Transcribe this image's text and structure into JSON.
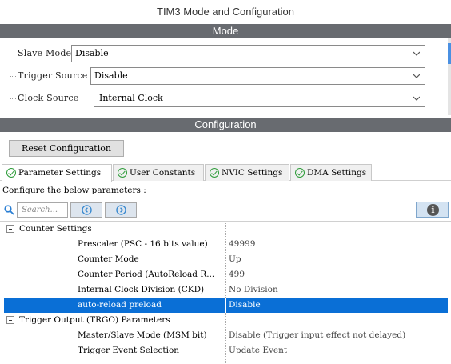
{
  "window": {
    "title": "TIM3 Mode and Configuration"
  },
  "mode": {
    "header": "Mode",
    "fields": [
      {
        "label": "Slave Mode",
        "value": "Disable"
      },
      {
        "label": "Trigger Source",
        "value": "Disable"
      },
      {
        "label": "Clock Source",
        "value": "Internal Clock"
      }
    ]
  },
  "configuration": {
    "header": "Configuration",
    "reset_label": "Reset Configuration",
    "tabs": [
      {
        "label": "Parameter Settings",
        "active": true
      },
      {
        "label": "User Constants",
        "active": false
      },
      {
        "label": "NVIC Settings",
        "active": false
      },
      {
        "label": "DMA Settings",
        "active": false
      }
    ],
    "instruction": "Configure the below parameters :",
    "search_placeholder": "Search...",
    "info_symbol": "i"
  },
  "parameters": {
    "groups": [
      {
        "name": "Counter Settings",
        "items": [
          {
            "name": "Prescaler (PSC - 16 bits value)",
            "value": "49999"
          },
          {
            "name": "Counter Mode",
            "value": "Up"
          },
          {
            "name": "Counter Period (AutoReload R...",
            "value": "499"
          },
          {
            "name": "Internal Clock Division (CKD)",
            "value": "No Division"
          },
          {
            "name": "auto-reload preload",
            "value": "Disable",
            "selected": true
          }
        ]
      },
      {
        "name": "Trigger Output (TRGO) Parameters",
        "items": [
          {
            "name": "Master/Slave Mode (MSM bit)",
            "value": "Disable (Trigger input effect not delayed)"
          },
          {
            "name": "Trigger Event Selection",
            "value": "Update Event"
          }
        ]
      }
    ]
  },
  "colors": {
    "section_bar": "#686b70",
    "selection": "#0a6fd6",
    "check_green": "#2e9c3a",
    "nav_blue": "#3a8ad0"
  }
}
